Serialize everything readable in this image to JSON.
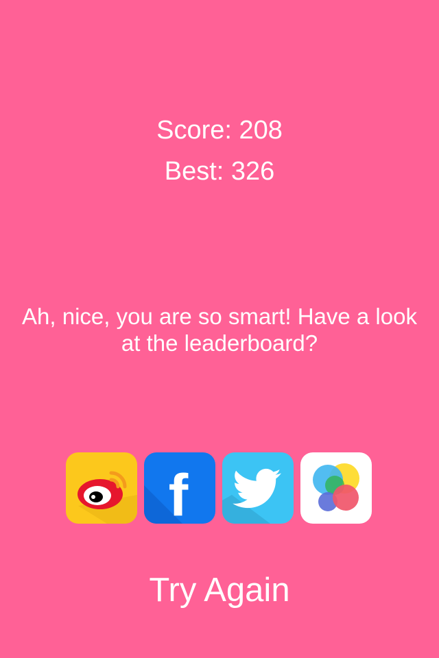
{
  "colors": {
    "background": "#FF6196",
    "text": "#ffffff",
    "weibo": "#FCC81C",
    "facebook": "#1177EE",
    "twitter": "#3CC4F4",
    "gamecenter": "#ffffff"
  },
  "results": {
    "score_text": "Score: 208",
    "best_text": "Best: 326"
  },
  "message": "Ah, nice, you are so smart! Have a look at the leaderboard?",
  "share": {
    "buttons": [
      {
        "name": "weibo",
        "icon": "weibo-icon"
      },
      {
        "name": "facebook",
        "icon": "facebook-icon",
        "glyph": "f"
      },
      {
        "name": "twitter",
        "icon": "twitter-icon"
      },
      {
        "name": "game-center",
        "icon": "game-center-icon"
      }
    ]
  },
  "actions": {
    "try_again_label": "Try Again"
  }
}
